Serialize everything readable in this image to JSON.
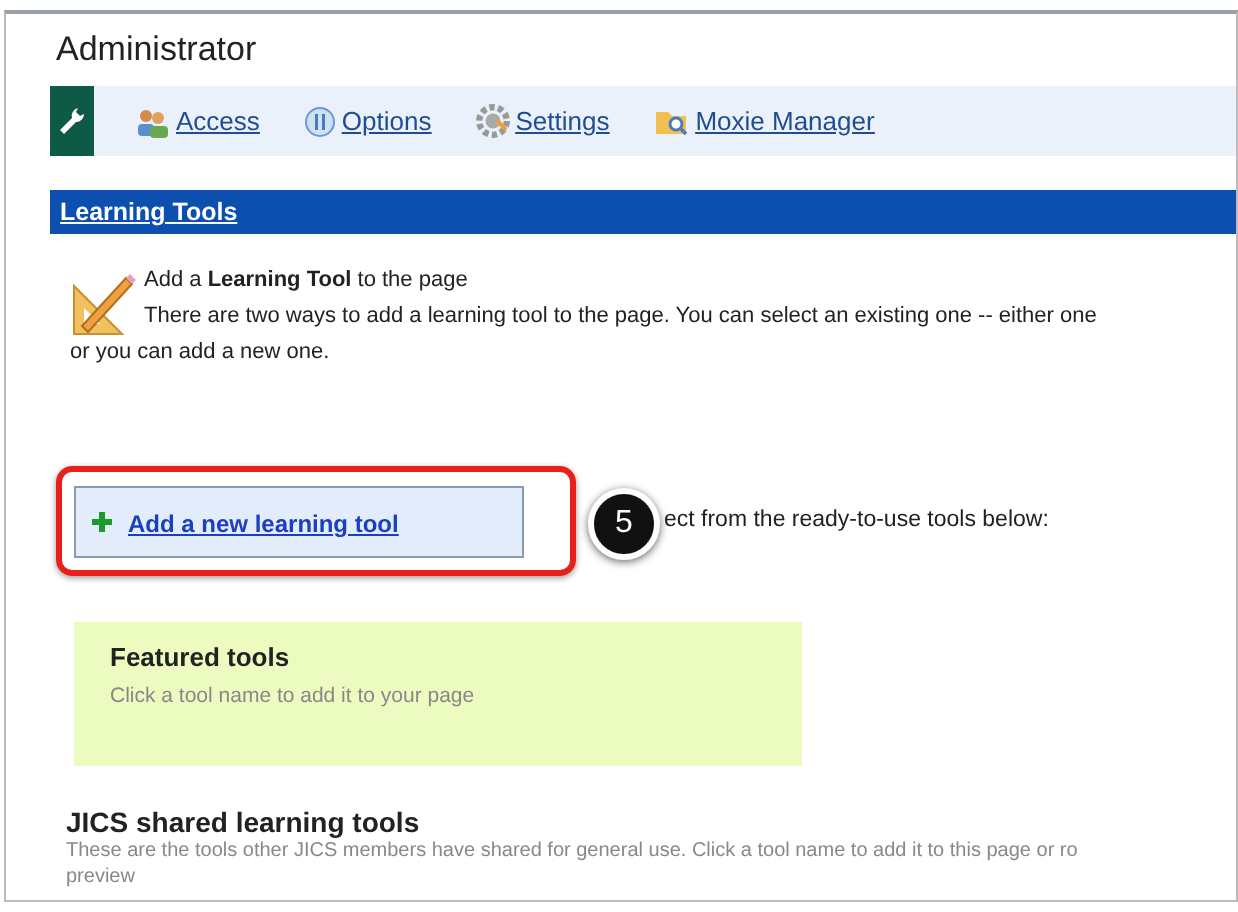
{
  "page_title": "Administrator",
  "toolbar": {
    "links": [
      {
        "label": "Access",
        "kind": "people"
      },
      {
        "label": "Options",
        "kind": "options"
      },
      {
        "label": "Settings",
        "kind": "gear"
      },
      {
        "label": "Moxie Manager",
        "kind": "folder"
      }
    ]
  },
  "section_header": "Learning Tools",
  "intro": {
    "heading": "Add a **Learning Tool** to the page",
    "lines": [
      "There are two ways to add a learning tool to the page. You can select an existing one -- either one",
      "or you can add a new one."
    ]
  },
  "add_button": "Add a new learning tool",
  "step_badge": "5",
  "select_text": "ect from the ready-to-use tools below:",
  "featured": {
    "title": "Featured tools",
    "hint": "Click a tool name to add it to your page"
  },
  "shared": {
    "title": "JICS shared learning tools",
    "lines": [
      "These are the tools other JICS members have shared for general use. Click a tool name to add it to this page or ro",
      "preview"
    ]
  }
}
